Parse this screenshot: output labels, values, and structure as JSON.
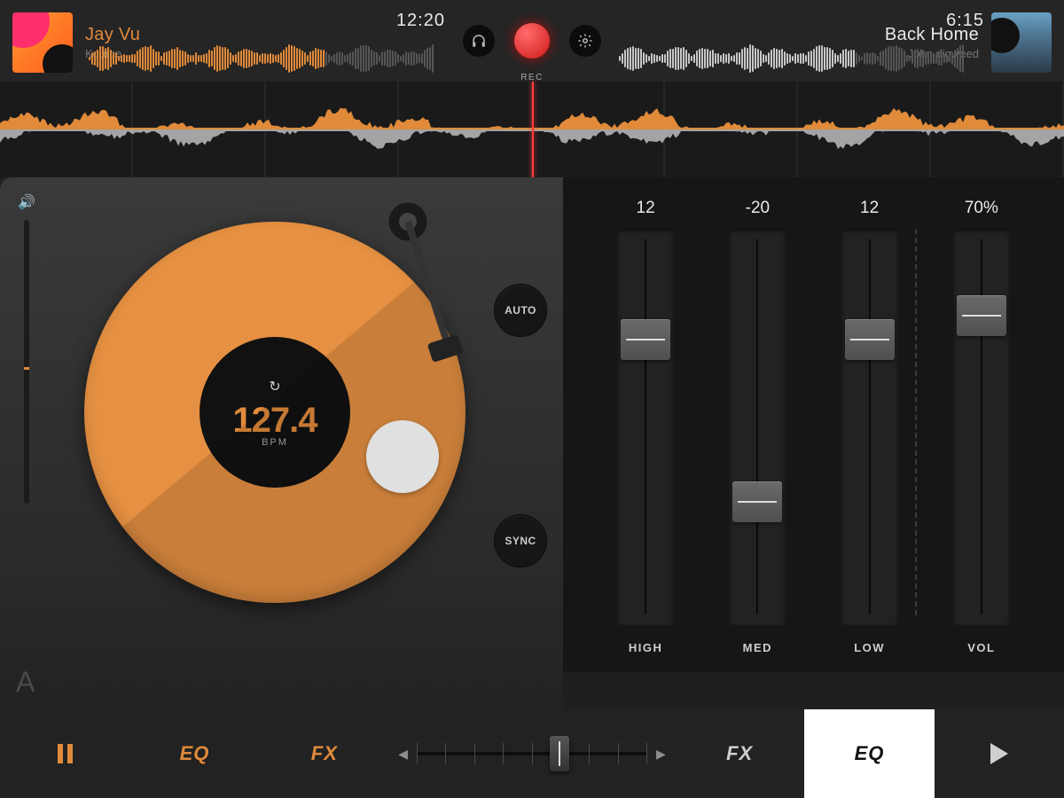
{
  "header": {
    "left": {
      "title": "Jay Vu",
      "artist": "Kource",
      "time": "12:20"
    },
    "right": {
      "title": "Back Home",
      "artist": "John digweed",
      "time": "6:15"
    },
    "rec_label": "REC"
  },
  "deck": {
    "bpm": "127.4",
    "bpm_label": "BPM",
    "auto": "AUTO",
    "sync": "SYNC",
    "letter": "A"
  },
  "eq": {
    "high": {
      "value": "12",
      "label": "HIGH",
      "pos": 0.28
    },
    "med": {
      "value": "-20",
      "label": "MED",
      "pos": 0.69
    },
    "low": {
      "value": "12",
      "label": "LOW",
      "pos": 0.28
    },
    "vol": {
      "value": "70%",
      "label": "VOL",
      "pos": 0.22
    }
  },
  "bottom": {
    "eq_a": "EQ",
    "fx_a": "FX",
    "fx_b": "FX",
    "eq_b": "EQ",
    "xfade_pos": 0.62
  }
}
